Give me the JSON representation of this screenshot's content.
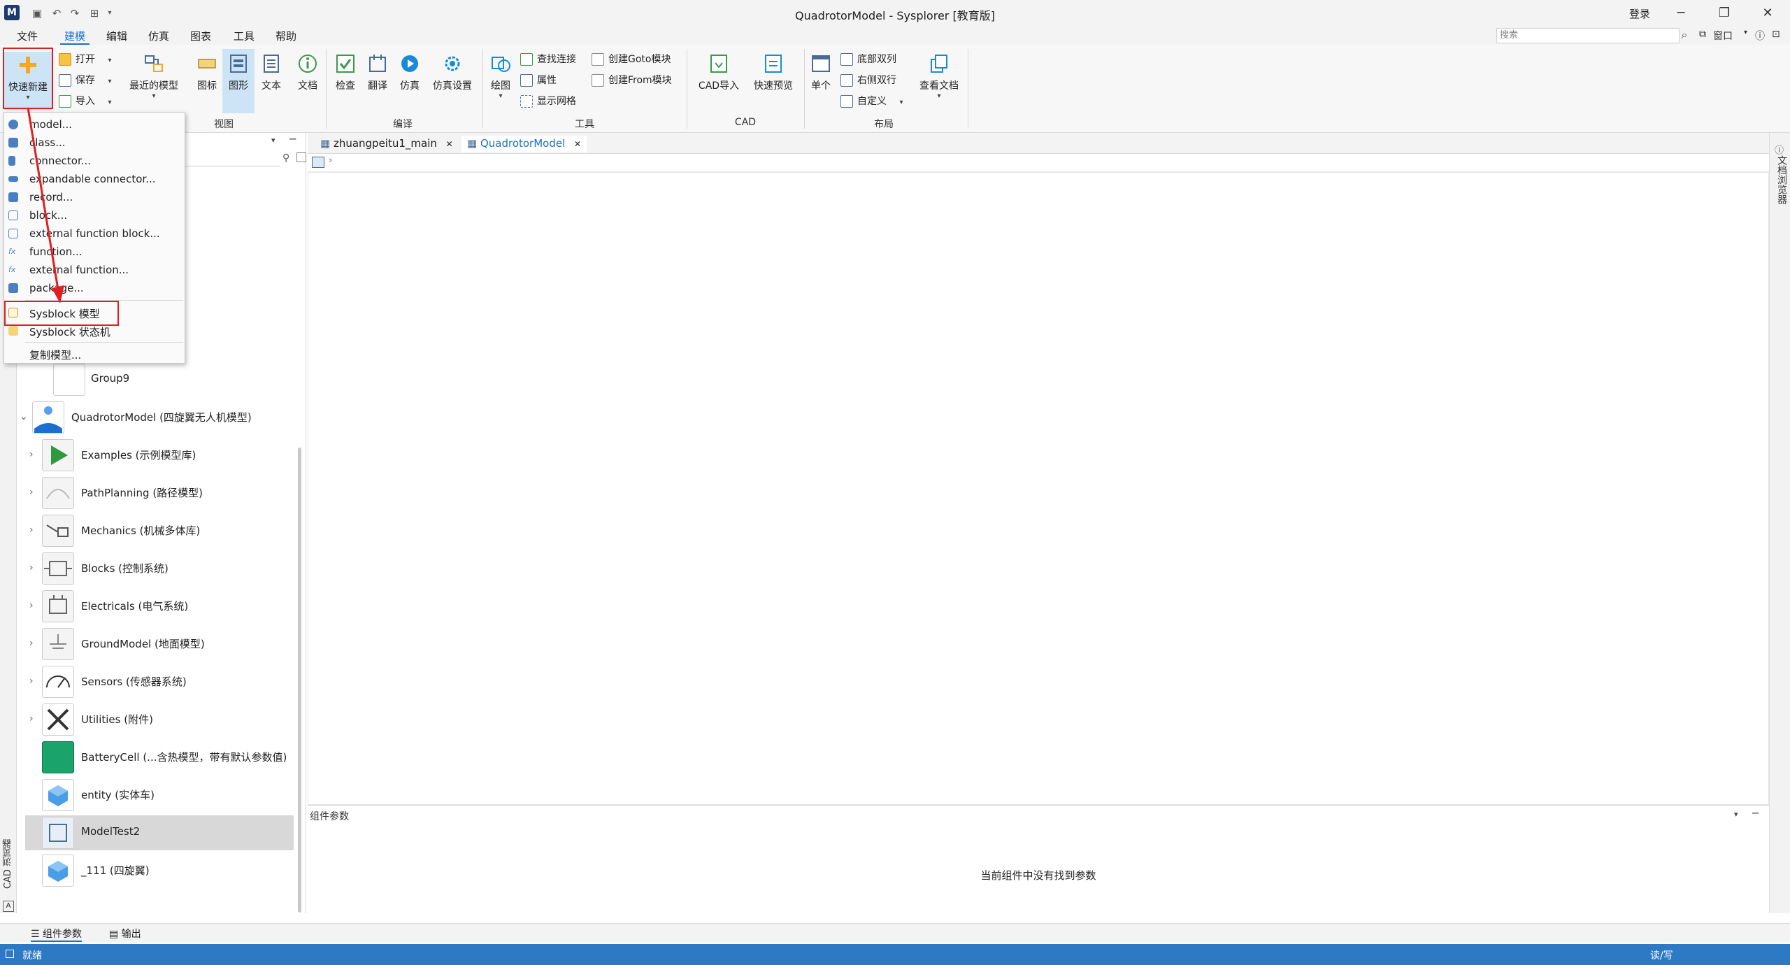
{
  "titlebar": {
    "title": "QuadrotorModel - Sysplorer [教育版]",
    "login": "登录"
  },
  "menu": {
    "tabs": [
      "文件",
      "建模",
      "编辑",
      "仿真",
      "图表",
      "工具",
      "帮助"
    ],
    "active": "建模"
  },
  "search": {
    "placeholder": "搜索"
  },
  "window_menu": "窗口",
  "ribbon": {
    "quick_new": "快速新建",
    "open": "打开",
    "save": "保存",
    "import": "导入",
    "recent_models": "最近的模型",
    "icon": "图标",
    "graphics": "图形",
    "text": "文本",
    "doc": "文档",
    "view_group": "视图",
    "check": "检查",
    "translate": "翻译",
    "simulate": "仿真",
    "sim_settings": "仿真设置",
    "compile_group": "编译",
    "draw": "绘图",
    "find_connection": "查找连接",
    "attributes": "属性",
    "show_grid": "显示网格",
    "create_goto": "创建Goto模块",
    "create_from": "创建From模块",
    "tools_group": "工具",
    "cad_import": "CAD导入",
    "quick_preview": "快速预览",
    "cad_group": "CAD",
    "single": "单个",
    "bottom_double": "底部双列",
    "right_double": "右侧双行",
    "custom": "自定义",
    "view_docs": "查看文档",
    "layout_group": "布局"
  },
  "dropdown": {
    "items": [
      {
        "label": "model...",
        "icon": "model-icon",
        "color": "#4a7fc1"
      },
      {
        "label": "class...",
        "icon": "class-icon",
        "color": "#4a7fc1"
      },
      {
        "label": "connector...",
        "icon": "connector-icon",
        "color": "#4a7fc1"
      },
      {
        "label": "expandable connector...",
        "icon": "expandable-connector-icon",
        "color": "#4a7fc1"
      },
      {
        "label": "record...",
        "icon": "record-icon",
        "color": "#4a7fc1"
      },
      {
        "label": "block...",
        "icon": "block-icon",
        "color": "#4a7fc1"
      },
      {
        "label": "external function block...",
        "icon": "external-function-block-icon",
        "color": "#4a7fc1"
      },
      {
        "label": "function...",
        "icon": "function-icon",
        "color": "#4a7fc1"
      },
      {
        "label": "external function...",
        "icon": "external-function-icon",
        "color": "#4a7fc1"
      },
      {
        "label": "package...",
        "icon": "package-icon",
        "color": "#4a7fc1"
      }
    ],
    "sysblock_model": "Sysblock 模型",
    "sysblock_state": "Sysblock 状态机",
    "copy_model": "复制模型..."
  },
  "tree": {
    "items": [
      {
        "label": "Group9",
        "icon": "group-icon",
        "expandable": false
      },
      {
        "label": "QuadrotorModel (四旋翼无人机模型)",
        "icon": "quadrotor-icon",
        "expandable": true,
        "expanded": true
      },
      {
        "label": "Examples (示例模型库)",
        "icon": "play-icon",
        "expandable": true
      },
      {
        "label": "PathPlanning (路径模型)",
        "icon": "path-icon",
        "expandable": true
      },
      {
        "label": "Mechanics (机械多体库)",
        "icon": "mechanics-icon",
        "expandable": true
      },
      {
        "label": "Blocks (控制系统)",
        "icon": "blocks-icon",
        "expandable": true
      },
      {
        "label": "Electricals (电气系统)",
        "icon": "electricals-icon",
        "expandable": true
      },
      {
        "label": "GroundModel (地面模型)",
        "icon": "ground-icon",
        "expandable": true
      },
      {
        "label": "Sensors (传感器系统)",
        "icon": "sensor-gauge-icon",
        "expandable": true
      },
      {
        "label": "Utilities (附件)",
        "icon": "wrench-icon",
        "expandable": true
      },
      {
        "label": "BatteryCell (...含热模型，带有默认参数值)",
        "icon": "battery-icon",
        "expandable": false
      },
      {
        "label": "entity (实体车)",
        "icon": "cube-icon",
        "expandable": false
      },
      {
        "label": "ModelTest2",
        "icon": "chip-icon",
        "expandable": false,
        "selected": true
      },
      {
        "label": "_111 (四旋翼)",
        "icon": "cube-icon",
        "expandable": false
      }
    ]
  },
  "doc_tabs": [
    {
      "label": "zhuangpeitu1_main",
      "active": false
    },
    {
      "label": "QuadrotorModel",
      "active": true
    }
  ],
  "params": {
    "title": "组件参数",
    "empty_message": "当前组件中没有找到参数"
  },
  "side_labels": {
    "cad_browser": "CAD 浏览器",
    "doc_browser": "文档浏览器"
  },
  "bottom_tabs": [
    "组件参数",
    "输出"
  ],
  "status": {
    "left": "就绪",
    "right": "读/写"
  },
  "colors": {
    "accent": "#1a6fd0",
    "status_bar": "#2d79c4",
    "highlight": "#e02020"
  }
}
